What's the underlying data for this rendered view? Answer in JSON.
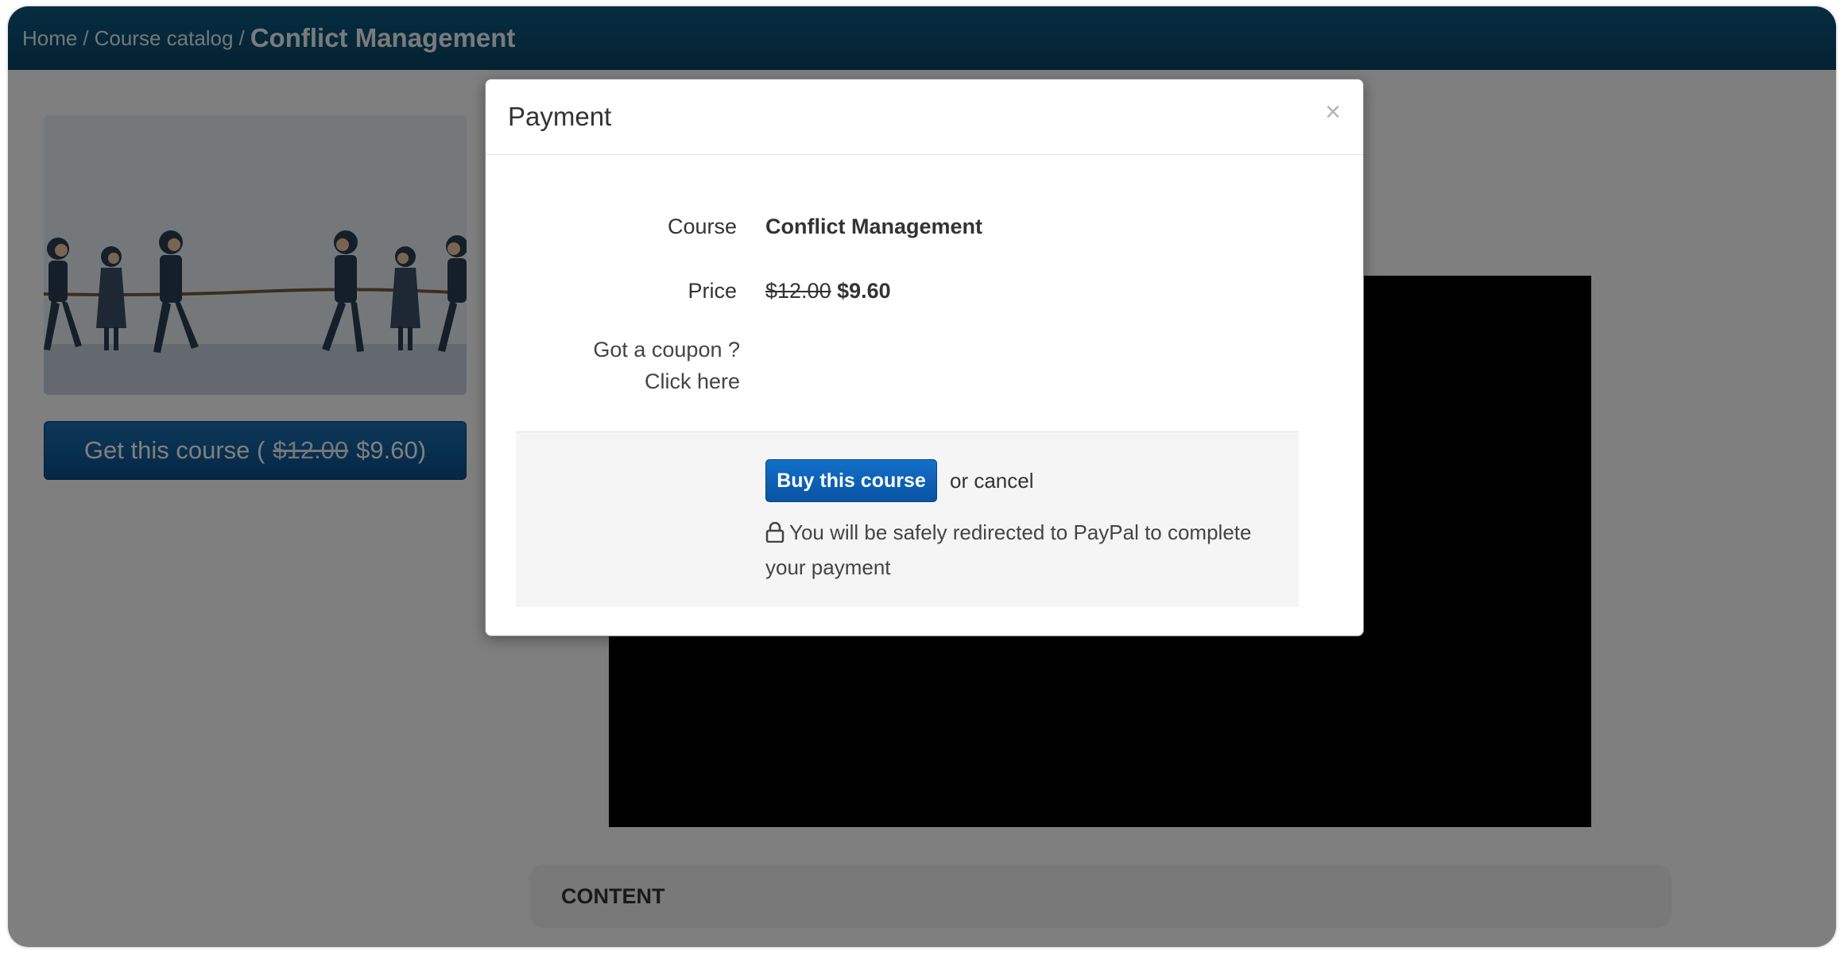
{
  "breadcrumb": {
    "home": "Home",
    "catalog": "Course catalog",
    "separator": "/",
    "current": "Conflict Management"
  },
  "course": {
    "get_button": {
      "prefix": "Get this course (",
      "old_price": "$12.00",
      "new_price": "$9.60)"
    },
    "content_label": "CONTENT"
  },
  "modal": {
    "title": "Payment",
    "close_symbol": "×",
    "course_label": "Course",
    "course_value": "Conflict Management",
    "price_label": "Price",
    "old_price": "$12.00",
    "new_price": "$9.60",
    "coupon_label": "Got a coupon ? Click here",
    "buy_button": "Buy this course",
    "cancel_text": "or cancel",
    "paypal_note": "You will be safely redirected to PayPal to complete your payment",
    "icon": "lock-icon"
  },
  "colors": {
    "topbar": "#0a4f73",
    "buy_button": "#0a5fb5",
    "overlay": "#808080",
    "video": "#000000"
  }
}
